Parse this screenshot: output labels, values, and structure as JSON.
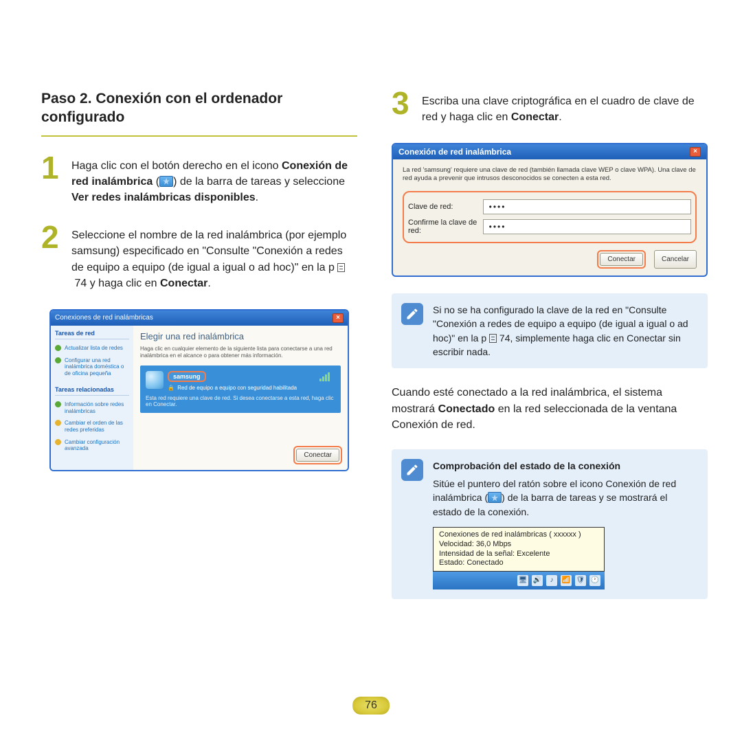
{
  "section_title": "Paso 2. Conexión con el ordenador configurado",
  "steps": {
    "s1": {
      "num": "1",
      "pre": "Haga clic con el botón derecho en el icono ",
      "b1": "Conexión de red inalámbrica",
      "mid": " de la barra de tareas y seleccione ",
      "b2": "Ver redes inalámbricas disponibles",
      "post": "."
    },
    "s2": {
      "num": "2",
      "text_a": "Seleccione el nombre de la red inalámbrica (por ejemplo samsung) especificado en \"Consulte \"Conexión a redes de equipo a equipo (de igual a igual o ad hoc)\" en la p ",
      "page_ref": "74",
      "text_b": " y haga clic en ",
      "b1": "Conectar",
      "post": "."
    },
    "s3": {
      "num": "3",
      "text_a": "Escriba una clave criptográfica en el cuadro de clave de red y haga clic en ",
      "b1": "Conectar",
      "post": "."
    }
  },
  "win1": {
    "title": "Conexiones de red inalámbricas",
    "side_head1": "Tareas de red",
    "link1": "Actualizar lista de redes",
    "link2": "Configurar una red inalámbrica doméstica o de oficina pequeña",
    "side_head2": "Tareas relacionadas",
    "link3": "Información sobre redes inalámbricas",
    "link4": "Cambiar el orden de las redes preferidas",
    "link5": "Cambiar configuración avanzada",
    "main_heading": "Elegir una red inalámbrica",
    "main_sub": "Haga clic en cualquier elemento de la siguiente lista para conectarse a una red inalámbrica en el alcance o para obtener más información.",
    "net_name": "samsung",
    "net_type": "Red de equipo a equipo con seguridad habilitada",
    "net_desc": "Esta red requiere una clave de red. Si desea conectarse a esta red, haga clic en Conectar.",
    "connect_btn": "Conectar"
  },
  "dlg": {
    "title": "Conexión de red inalámbrica",
    "info": "La red 'samsung' requiere una clave de red (también llamada clave WEP o clave WPA). Una clave de red ayuda a prevenir que intrusos desconocidos se conecten a esta red.",
    "label1": "Clave de red:",
    "label2": "Confirme la clave de red:",
    "dots": "••••",
    "btn_connect": "Conectar",
    "btn_cancel": "Cancelar"
  },
  "note1": {
    "text_a": "Si no se ha configurado la clave de la red en \"Consulte \"Conexión a redes de equipo a equipo (de igual a igual o ad hoc)\" en la p ",
    "page_ref": "74",
    "text_b": ", simplemente haga clic en Conectar sin escribir nada."
  },
  "body_para": {
    "pre": "Cuando esté conectado a la red inalámbrica, el sistema mostrará ",
    "b1": "Conectado",
    "post": " en la red seleccionada de la ventana Conexión de red."
  },
  "note2": {
    "title": "Comprobación del estado de la conexión",
    "text": "Sitúe el puntero del ratón sobre el icono Conexión de red inalámbrica ( ) de la barra de tareas y se mostrará el estado de la conexión.",
    "tooltip_l1": "Conexiones de red inalámbricas (  xxxxxx )",
    "tooltip_l2": "Velocidad: 36,0 Mbps",
    "tooltip_l3": "Intensidad de la señal: Excelente",
    "tooltip_l4": "Estado: Conectado"
  },
  "page_number": "76"
}
